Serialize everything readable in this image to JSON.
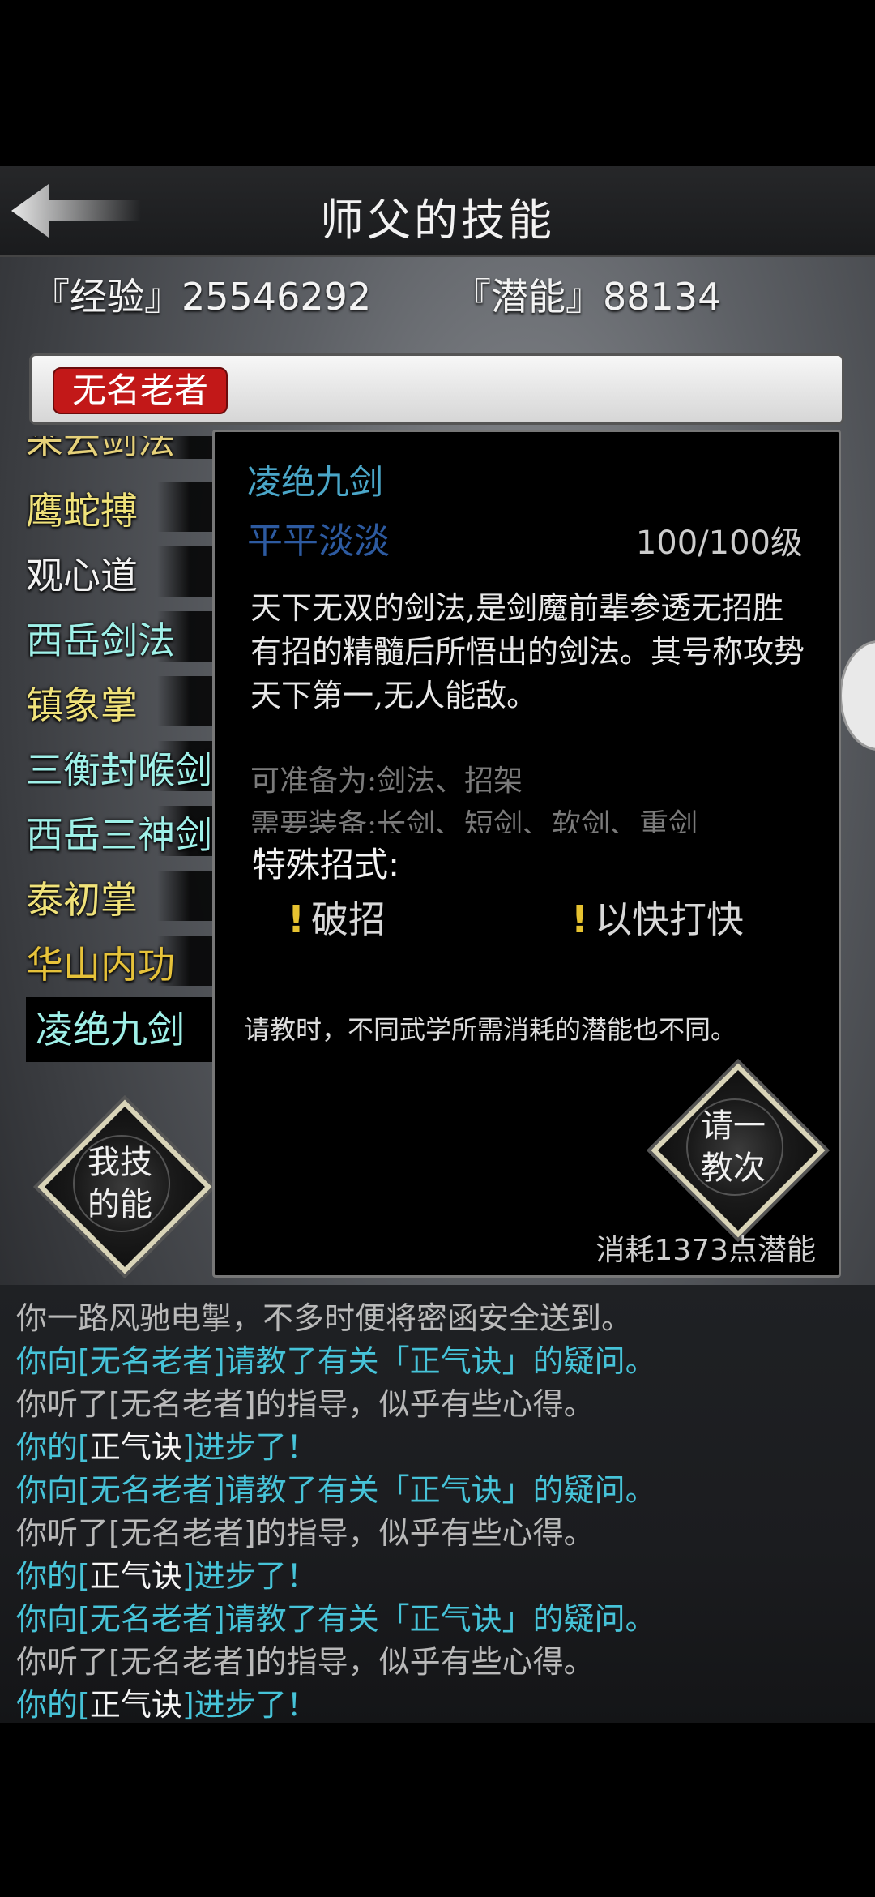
{
  "header": {
    "title": "师父的技能"
  },
  "stats": {
    "exp_label": "『经验』",
    "exp_value": "25546292",
    "pot_label": "『潜能』",
    "pot_value": "88134"
  },
  "master": {
    "name": "无名老者"
  },
  "skills": [
    {
      "label": "采云剑法",
      "color": "#e6d17a"
    },
    {
      "label": "鹰蛇搏",
      "color": "#f0e27a"
    },
    {
      "label": "观心道",
      "color": "#f2f2f2"
    },
    {
      "label": "西岳剑法",
      "color": "#9ff0e8"
    },
    {
      "label": "镇象掌",
      "color": "#f0e27a"
    },
    {
      "label": "三衡封喉剑",
      "color": "#9ff0e8"
    },
    {
      "label": "西岳三神剑",
      "color": "#9ff0e8"
    },
    {
      "label": "泰初掌",
      "color": "#f0e27a"
    },
    {
      "label": "华山内功",
      "color": "#e6c23a"
    },
    {
      "label": "凌绝九剑",
      "color": "#9ff0e8"
    }
  ],
  "detail": {
    "name": "凌绝九剑",
    "rank": "平平淡淡",
    "level": "100/100级",
    "description": "天下无双的剑法,是剑魔前辈参透无招胜有招的精髓后所悟出的剑法。其号称攻势天下第一,无人能敌。",
    "equip_line1": "可准备为:剑法、招架",
    "equip_line2": "需要装备:长剑、短剑、软剑、重剑",
    "special_title": "特殊招式:",
    "moves": [
      "破招",
      "以快打快"
    ],
    "note": "请教时，不同武学所需消耗的潜能也不同。",
    "teach_button_line1": "请一",
    "teach_button_line2": "教次",
    "cost": "消耗1373点潜能"
  },
  "my_skills_button": {
    "line1": "我技",
    "line2": "的能"
  },
  "log": [
    {
      "text": "你一路风驰电掣，不多时便将密函安全送到。",
      "color": "plain"
    },
    {
      "text": "你向[无名老者]请教了有关「正气诀」的疑问。",
      "color": "blue"
    },
    {
      "text": "你听了[无名老者]的指导，似乎有些心得。",
      "color": "plain"
    },
    {
      "pre": "你的[",
      "mid": "正气诀",
      "post": "]进步了！",
      "color": "blue"
    },
    {
      "text": "你向[无名老者]请教了有关「正气诀」的疑问。",
      "color": "blue"
    },
    {
      "text": "你听了[无名老者]的指导，似乎有些心得。",
      "color": "plain"
    },
    {
      "pre": "你的[",
      "mid": "正气诀",
      "post": "]进步了！",
      "color": "blue"
    },
    {
      "text": "你向[无名老者]请教了有关「正气诀」的疑问。",
      "color": "blue"
    },
    {
      "text": "你听了[无名老者]的指导，似乎有些心得。",
      "color": "plain"
    },
    {
      "pre": "你的[",
      "mid": "正气诀",
      "post": "]进步了！",
      "color": "blue"
    }
  ]
}
